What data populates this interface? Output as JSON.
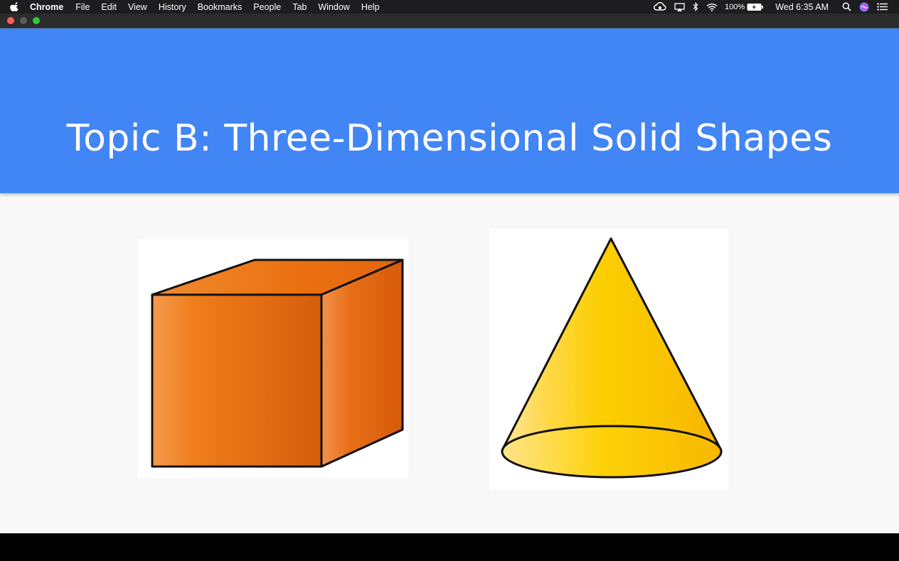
{
  "menubar": {
    "app_name": "Chrome",
    "items": [
      "File",
      "Edit",
      "View",
      "History",
      "Bookmarks",
      "People",
      "Tab",
      "Window",
      "Help"
    ],
    "battery_percent": "100%",
    "clock": "Wed 6:35 AM"
  },
  "slide": {
    "title": "Topic B: Three-Dimensional Solid Shapes",
    "header_color": "#4285f4",
    "images": [
      "cube",
      "cone"
    ]
  }
}
